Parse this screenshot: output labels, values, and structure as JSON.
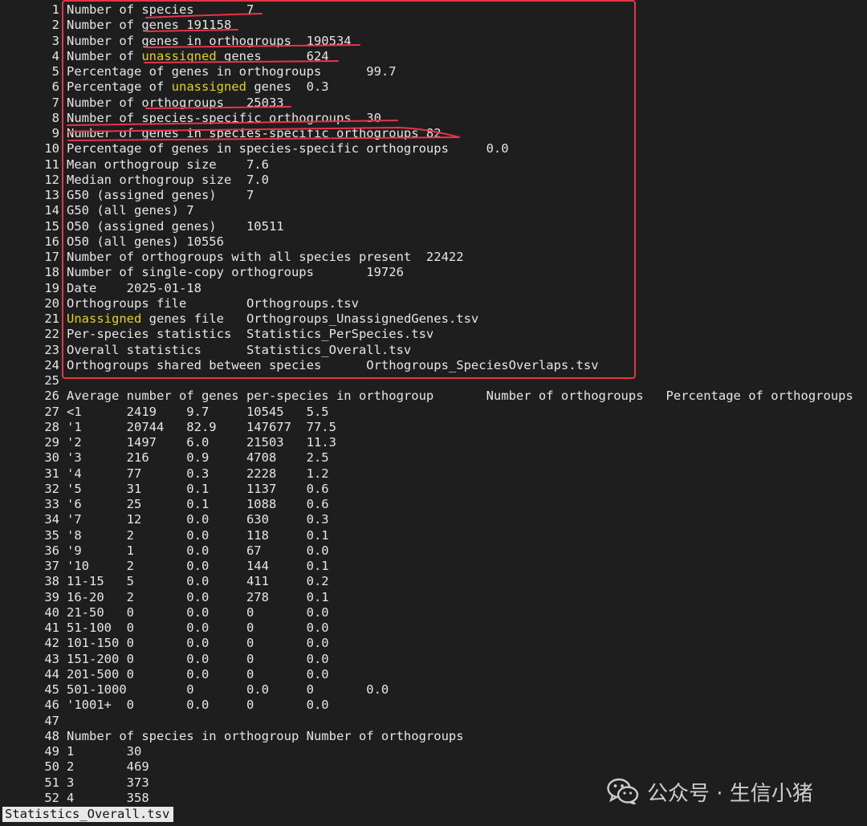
{
  "editor": {
    "highlight_word": "unassigned",
    "lines": [
      "Number of species\t7",
      "Number of genes 191158",
      "Number of genes in orthogroups  190534",
      "Number of unassigned genes\t624",
      "Percentage of genes in orthogroups\t99.7",
      "Percentage of unassigned genes  0.3",
      "Number of orthogroups   25033",
      "Number of species-specific orthogroups  30",
      "Number of genes in species-specific orthogroups 82",
      "Percentage of genes in species-specific orthogroups\t0.0",
      "Mean orthogroup size    7.6",
      "Median orthogroup size  7.0",
      "G50 (assigned genes)    7",
      "G50 (all genes) 7",
      "O50 (assigned genes)    10511",
      "O50 (all genes) 10556",
      "Number of orthogroups with all species present  22422",
      "Number of single-copy orthogroups\t19726",
      "Date    2025-01-18",
      "Orthogroups file\tOrthogroups.tsv",
      "Unassigned genes file   Orthogroups_UnassignedGenes.tsv",
      "Per-species statistics  Statistics_PerSpecies.tsv",
      "Overall statistics\tStatistics_Overall.tsv",
      "Orthogroups shared between species\tOrthogroups_SpeciesOverlaps.tsv",
      "",
      "Average number of genes per-species in orthogroup\tNumber of orthogroups   Percentage of orthogroups",
      "<1\t2419\t9.7\t10545   5.5",
      "'1\t20744   82.9\t147677  77.5",
      "'2\t1497\t6.0\t21503   11.3",
      "'3\t216\t0.9\t4708\t2.5",
      "'4\t77\t0.3\t2228\t1.2",
      "'5\t31\t0.1\t1137\t0.6",
      "'6\t25\t0.1\t1088\t0.6",
      "'7\t12\t0.0\t630\t0.3",
      "'8\t2\t0.0\t118\t0.1",
      "'9\t1\t0.0\t67\t0.0",
      "'10\t2\t0.0\t144\t0.1",
      "11-15\t5\t0.0\t411\t0.2",
      "16-20\t2\t0.0\t278\t0.1",
      "21-50\t0\t0.0\t0\t0.0",
      "51-100  0\t0.0\t0\t0.0",
      "101-150 0\t0.0\t0\t0.0",
      "151-200 0\t0.0\t0\t0.0",
      "201-500 0\t0.0\t0\t0.0",
      "501-1000\t0\t0.0\t0\t0.0",
      "'1001+  0\t0.0\t0\t0.0",
      "",
      "Number of species in orthogroup Number of orthogroups",
      "1\t30",
      "2\t469",
      "3\t373",
      "4\t358"
    ]
  },
  "status_bar": {
    "filename": "Statistics_Overall.tsv"
  },
  "watermark": {
    "text": "公众号 · 生信小猪",
    "icon": "wechat-icon"
  },
  "colors": {
    "background": "#1e1e1e",
    "text": "#e6e6e6",
    "highlight": "#e3d020",
    "annotation": "#e8344a"
  }
}
